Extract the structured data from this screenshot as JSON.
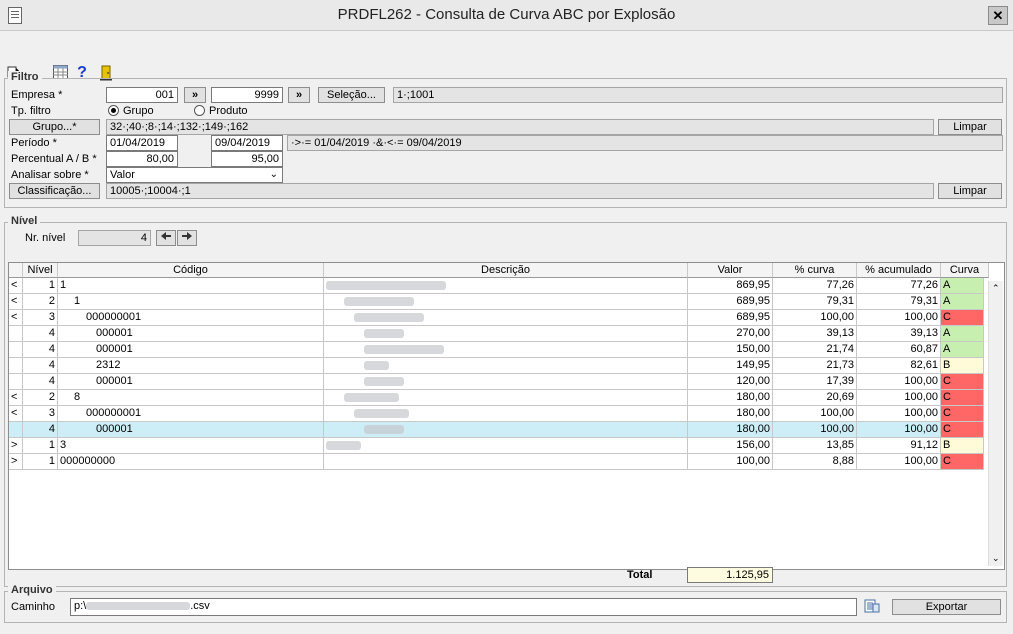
{
  "window": {
    "title": "PRDFL262 - Consulta de Curva ABC por Explosão",
    "close_symbol": "✕"
  },
  "toolbar": {
    "exit_icon": "export-icon",
    "grid_icon": "grid-icon",
    "help_icon": "help-icon",
    "door_icon": "door-exit-icon",
    "help_symbol": "?"
  },
  "filtro": {
    "legend": "Filtro",
    "empresa_label": "Empresa *",
    "empresa_from": "001",
    "empresa_to": "9999",
    "lookup_symbol": "»",
    "selecao_button": "Seleção...",
    "selecao_value": "1·;1001",
    "tp_filtro_label": "Tp. filtro",
    "radio_grupo": "Grupo",
    "radio_produto": "Produto",
    "grupo_button": "Grupo...*",
    "grupo_value": "32·;40·;8·;14·;132·;149·;162",
    "limpar_button": "Limpar",
    "periodo_label": "Período *",
    "periodo_from": "01/04/2019",
    "periodo_to": "09/04/2019",
    "periodo_expr": "·>·= 01/04/2019 ·&·<·= 09/04/2019",
    "percentual_label": "Percentual A / B *",
    "percentual_a": "80,00",
    "percentual_b": "95,00",
    "analisar_label": "Analisar sobre *",
    "analisar_value": "Valor",
    "classificacao_button": "Classificação...",
    "classificacao_value": "10005·;10004·;1"
  },
  "nivel": {
    "legend": "Nível",
    "nr_nivel_label": "Nr. nível",
    "nr_nivel_value": "4"
  },
  "grid": {
    "headers": [
      "Nível",
      "Código",
      "Descrição",
      "Valor",
      "% curva",
      "% acumulado",
      "Curva"
    ],
    "rows": [
      {
        "exp": "<",
        "nivel": "1",
        "codigo": "1",
        "valor": "869,95",
        "curva_pct": "77,26",
        "acum": "77,26",
        "curva": "A"
      },
      {
        "exp": "<",
        "nivel": "2",
        "codigo": "1",
        "valor": "689,95",
        "curva_pct": "79,31",
        "acum": "79,31",
        "curva": "A"
      },
      {
        "exp": "<",
        "nivel": "3",
        "codigo": "000000001",
        "valor": "689,95",
        "curva_pct": "100,00",
        "acum": "100,00",
        "curva": "C"
      },
      {
        "exp": "",
        "nivel": "4",
        "codigo": "000001",
        "valor": "270,00",
        "curva_pct": "39,13",
        "acum": "39,13",
        "curva": "A"
      },
      {
        "exp": "",
        "nivel": "4",
        "codigo": "000001",
        "valor": "150,00",
        "curva_pct": "21,74",
        "acum": "60,87",
        "curva": "A"
      },
      {
        "exp": "",
        "nivel": "4",
        "codigo": "2312",
        "valor": "149,95",
        "curva_pct": "21,73",
        "acum": "82,61",
        "curva": "B"
      },
      {
        "exp": "",
        "nivel": "4",
        "codigo": "000001",
        "valor": "120,00",
        "curva_pct": "17,39",
        "acum": "100,00",
        "curva": "C"
      },
      {
        "exp": "<",
        "nivel": "2",
        "codigo": "8",
        "valor": "180,00",
        "curva_pct": "20,69",
        "acum": "100,00",
        "curva": "C"
      },
      {
        "exp": "<",
        "nivel": "3",
        "codigo": "000000001",
        "valor": "180,00",
        "curva_pct": "100,00",
        "acum": "100,00",
        "curva": "C"
      },
      {
        "exp": "",
        "nivel": "4",
        "codigo": "000001",
        "valor": "180,00",
        "curva_pct": "100,00",
        "acum": "100,00",
        "curva": "C",
        "selected": true
      },
      {
        "exp": ">",
        "nivel": "1",
        "codigo": "3",
        "valor": "156,00",
        "curva_pct": "13,85",
        "acum": "91,12",
        "curva": "B"
      },
      {
        "exp": ">",
        "nivel": "1",
        "codigo": "000000000",
        "valor": "100,00",
        "curva_pct": "8,88",
        "acum": "100,00",
        "curva": "C"
      }
    ],
    "colors": {
      "A": "#c6efb0",
      "B": "#fffbd8",
      "C": "#ff6666",
      "selected": "#cdeef7"
    },
    "total_label": "Total",
    "total_value": "1.125,95"
  },
  "arquivo": {
    "legend": "Arquivo",
    "caminho_label": "Caminho",
    "caminho_prefix": "p:\\",
    "caminho_suffix": ".csv",
    "exportar_button": "Exportar"
  }
}
